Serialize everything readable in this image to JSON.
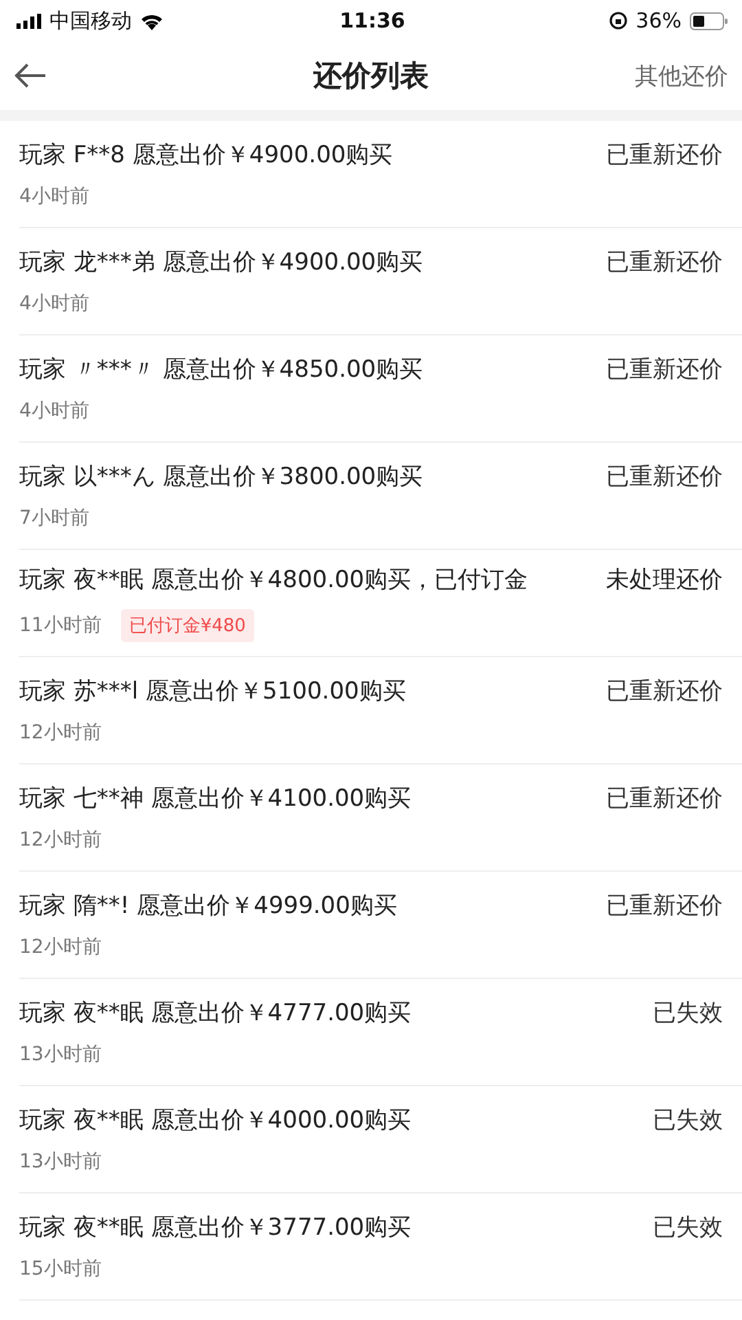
{
  "status_bar": {
    "carrier": "中国移动",
    "time": "11:36",
    "battery": "36%"
  },
  "nav": {
    "title": "还价列表",
    "action": "其他还价"
  },
  "offers": [
    {
      "text": "玩家 F**8 愿意出价￥4900.00购买",
      "time": "4小时前",
      "status": "已重新还价"
    },
    {
      "text": "玩家 龙***弟 愿意出价￥4900.00购买",
      "time": "4小时前",
      "status": "已重新还价"
    },
    {
      "text": "玩家 〃***〃 愿意出价￥4850.00购买",
      "time": "4小时前",
      "status": "已重新还价"
    },
    {
      "text": "玩家 以***ん 愿意出价￥3800.00购买",
      "time": "7小时前",
      "status": "已重新还价"
    },
    {
      "text": "玩家 夜**眠 愿意出价￥4800.00购买，已付订金",
      "time": "11小时前",
      "status": "未处理还价",
      "tag": "已付订金¥480"
    },
    {
      "text": "玩家 苏***l 愿意出价￥5100.00购买",
      "time": "12小时前",
      "status": "已重新还价"
    },
    {
      "text": "玩家 七**神 愿意出价￥4100.00购买",
      "time": "12小时前",
      "status": "已重新还价"
    },
    {
      "text": "玩家 隋**!  愿意出价￥4999.00购买",
      "time": "12小时前",
      "status": "已重新还价"
    },
    {
      "text": "玩家 夜**眠 愿意出价￥4777.00购买",
      "time": "13小时前",
      "status": "已失效"
    },
    {
      "text": "玩家 夜**眠 愿意出价￥4000.00购买",
      "time": "13小时前",
      "status": "已失效"
    },
    {
      "text": "玩家 夜**眠 愿意出价￥3777.00购买",
      "time": "15小时前",
      "status": "已失效"
    }
  ]
}
